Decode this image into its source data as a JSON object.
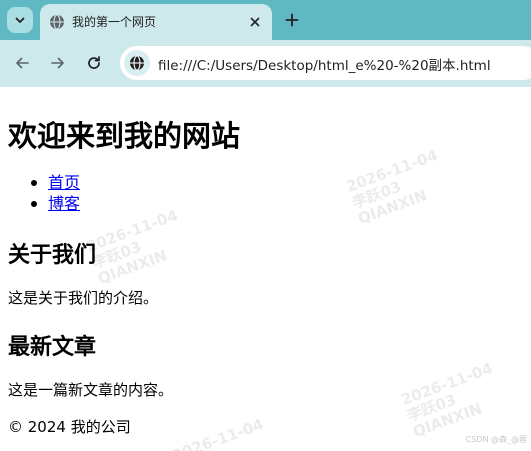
{
  "browser": {
    "tab": {
      "title": "我的第一个网页"
    },
    "url": "file:///C:/Users/Desktop/html_e%20-%20副本.html",
    "icons": {
      "tab_list": "chevron-down-icon",
      "favicon": "globe-icon",
      "close": "close-icon",
      "new_tab": "plus-icon",
      "back": "arrow-left-icon",
      "forward": "arrow-right-icon",
      "reload": "reload-icon",
      "site_info": "site-info-icon"
    },
    "colors": {
      "frame": "#5fb8c2",
      "toolbar": "#cde9ec",
      "link": "#0000ee"
    }
  },
  "page": {
    "heading": "欢迎来到我的网站",
    "nav": [
      "首页",
      "博客"
    ],
    "about": {
      "title": "关于我们",
      "text": "这是关于我们的介绍。"
    },
    "articles": {
      "title": "最新文章",
      "text": "这是一篇新文章的内容。"
    },
    "footer": "© 2024 我的公司"
  },
  "watermark": {
    "date": "2026-11-04",
    "name": "李跃03",
    "id": "QIANXIN"
  },
  "csdn_credit": "CSDN @森_@蓉"
}
